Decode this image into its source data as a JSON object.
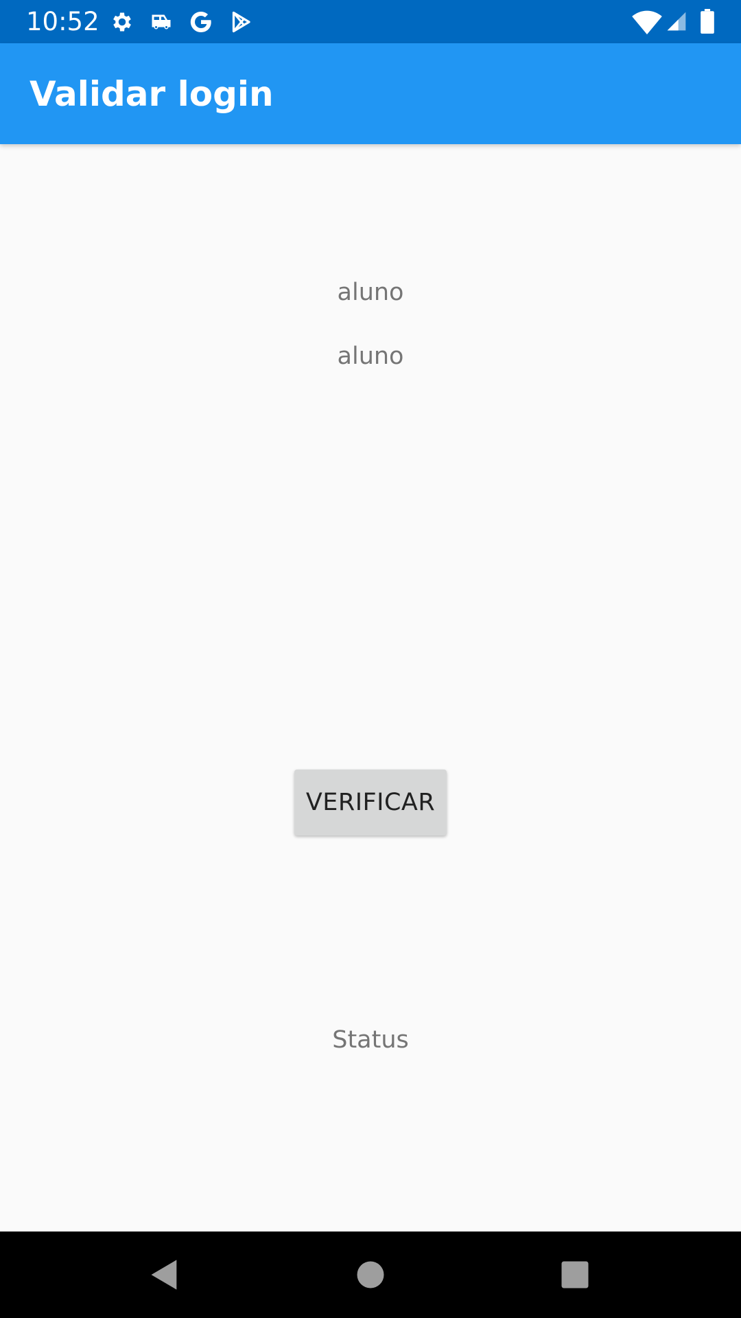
{
  "status_bar": {
    "time": "10:52",
    "left_icons": [
      "gear-icon",
      "car-icon",
      "google-icon",
      "play-store-icon"
    ],
    "right_icons": [
      "wifi-icon",
      "signal-icon",
      "battery-icon"
    ],
    "background": "#0069c0"
  },
  "app_bar": {
    "title": "Validar login",
    "background": "#2196f3"
  },
  "form": {
    "user_value": "aluno",
    "password_value": "aluno",
    "verify_label": "VERIFICAR",
    "status": "Status"
  },
  "nav_bar": {
    "buttons": [
      "back-icon",
      "home-icon",
      "recents-icon"
    ]
  }
}
